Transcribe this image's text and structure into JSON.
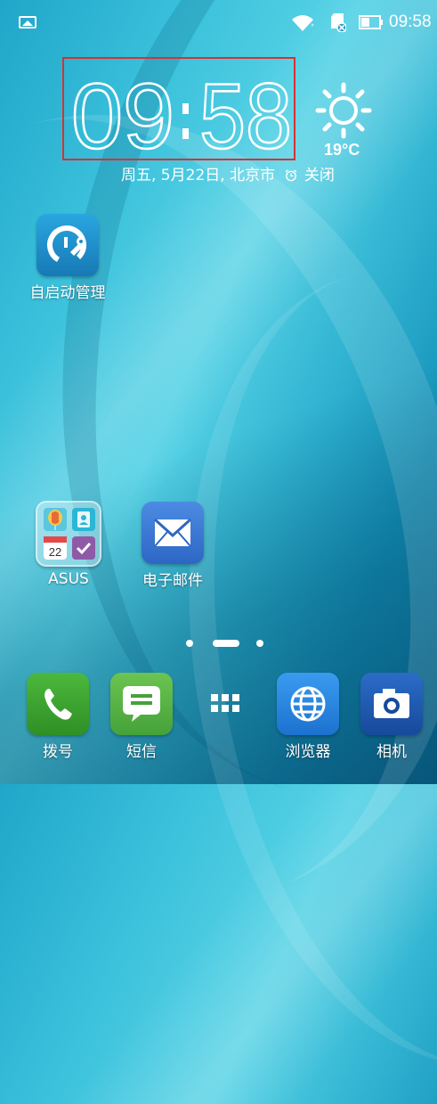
{
  "status_bar": {
    "time": "09:58",
    "icons": [
      "gallery-icon",
      "wifi-icon",
      "sd-card-icon",
      "battery-icon"
    ]
  },
  "clock_widget": {
    "time_hours": "09",
    "time_minutes": "58",
    "weather_temp": "19°C",
    "weather_icon": "sun-icon",
    "date_text": "周五, 5月22日, 北京市",
    "alarm_text": "关闭"
  },
  "desktop_apps": [
    {
      "label": "自启动管理",
      "icon": "autostart-manager-icon",
      "color": "#1e8fc6"
    }
  ],
  "folder": {
    "label": "ASUS",
    "calendar_day": "22",
    "mini_colors": [
      "#f2c94c",
      "#2bb6d6",
      "#ffffff",
      "#8e5aa8"
    ]
  },
  "email_app": {
    "label": "电子邮件",
    "icon": "mail-icon",
    "color": "#3b7bd6"
  },
  "page_indicator": {
    "pages": 3,
    "current": 2
  },
  "dock": [
    {
      "label": "拨号",
      "icon": "phone-icon",
      "color": "#43a935"
    },
    {
      "label": "短信",
      "icon": "message-icon",
      "color": "#5cb84a"
    },
    {
      "label": "",
      "icon": "app-drawer-icon",
      "color": ""
    },
    {
      "label": "浏览器",
      "icon": "globe-icon",
      "color": "#1e88e5"
    },
    {
      "label": "相机",
      "icon": "camera-icon",
      "color": "#1f5fb8"
    }
  ]
}
